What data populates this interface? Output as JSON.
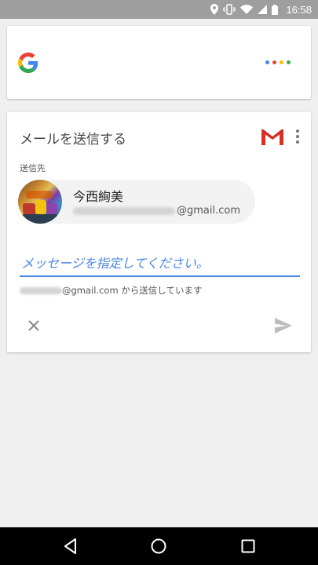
{
  "status_bar": {
    "time": "16:58",
    "icons": [
      "location-icon",
      "vibrate-icon",
      "wifi-icon",
      "signal-icon",
      "battery-icon"
    ]
  },
  "search_card": {
    "logo": "google-g-icon",
    "assistant_dot_colors": [
      "#4285F4",
      "#EA4335",
      "#FBBC05",
      "#34A853"
    ]
  },
  "mail_card": {
    "title": "メールを送信する",
    "to_label": "送信先",
    "recipient": {
      "name": "今西絢美",
      "email_domain": "@gmail.com"
    },
    "message_placeholder": "メッセージを指定してください。",
    "sender_suffix": "@gmail.com から送信しています",
    "accent_color": "#4a86e8"
  },
  "nav_bar": {
    "buttons": [
      "back-icon",
      "home-icon",
      "recents-icon"
    ]
  }
}
